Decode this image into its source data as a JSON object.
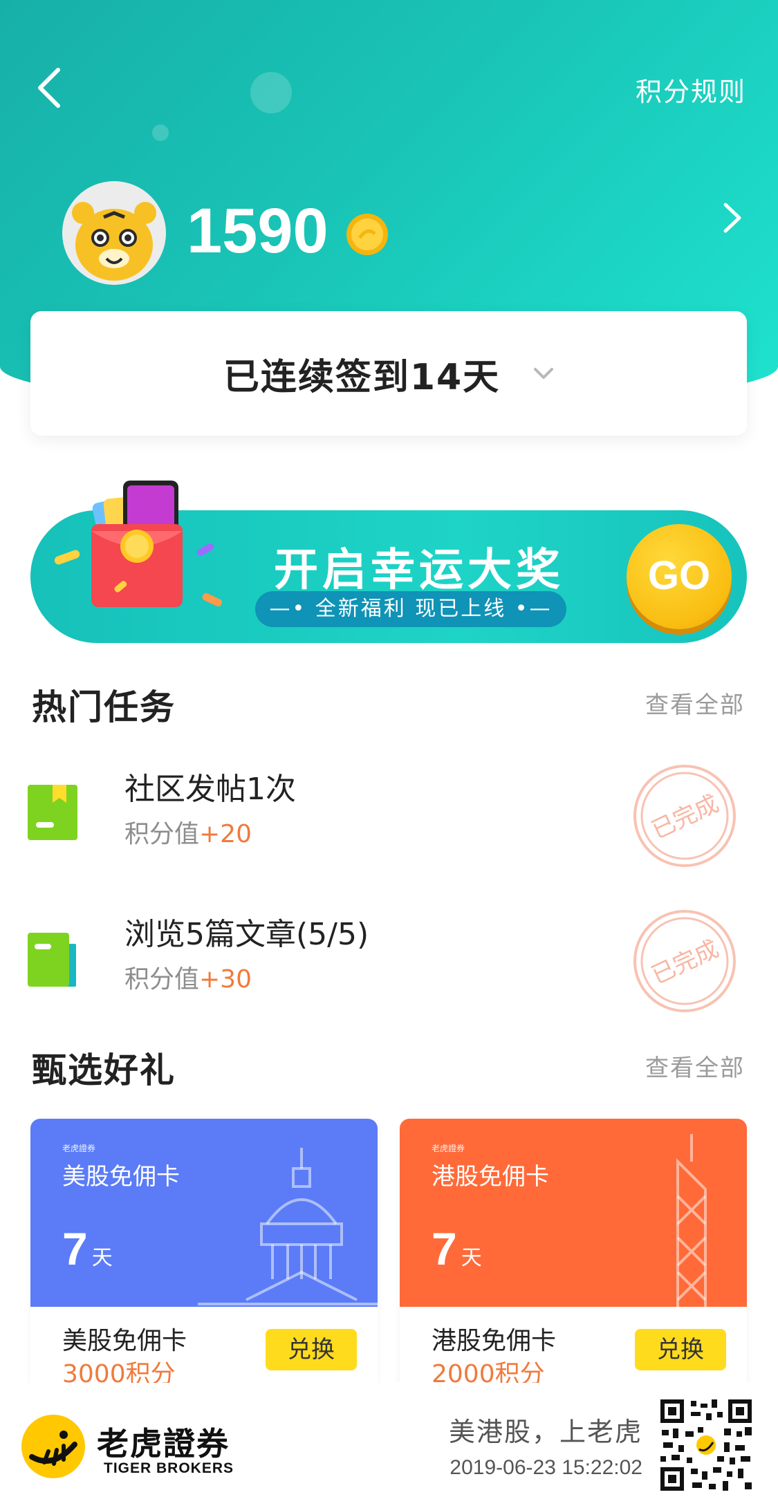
{
  "header": {
    "rules_label": "积分规则"
  },
  "profile": {
    "points": "1590"
  },
  "signin": {
    "label": "已连续签到14天"
  },
  "banner": {
    "title": "开启幸运大奖",
    "subtitle": "—• 全新福利 现已上线 •—",
    "go_label": "GO"
  },
  "hot_tasks": {
    "title": "热门任务",
    "view_all": "查看全部",
    "items": [
      {
        "title": "社区发帖1次",
        "points_label": "积分值",
        "points_value": "+20",
        "status": "已完成"
      },
      {
        "title": "浏览5篇文章(5/5)",
        "points_label": "积分值",
        "points_value": "+30",
        "status": "已完成"
      }
    ]
  },
  "gifts": {
    "title": "甄选好礼",
    "view_all": "查看全部",
    "items": [
      {
        "brand": "老虎證券",
        "card_title": "美股免佣卡",
        "days": "7",
        "days_unit": "天",
        "name": "美股免佣卡",
        "cost": "3000积分",
        "redeem_label": "兑换",
        "color": "#5b7cf6"
      },
      {
        "brand": "老虎證券",
        "card_title": "港股免佣卡",
        "days": "7",
        "days_unit": "天",
        "name": "港股免佣卡",
        "cost": "2000积分",
        "redeem_label": "兑换",
        "color": "#ff6a38"
      }
    ]
  },
  "footer": {
    "logo_cn": "老虎證券",
    "logo_en": "TIGER BROKERS",
    "slogan": "美港股，上老虎",
    "timestamp": "2019-06-23 15:22:02"
  },
  "colors": {
    "accent_teal": "#1ccfc1",
    "points_orange": "#f07a3c",
    "button_yellow": "#ffdb1d"
  }
}
